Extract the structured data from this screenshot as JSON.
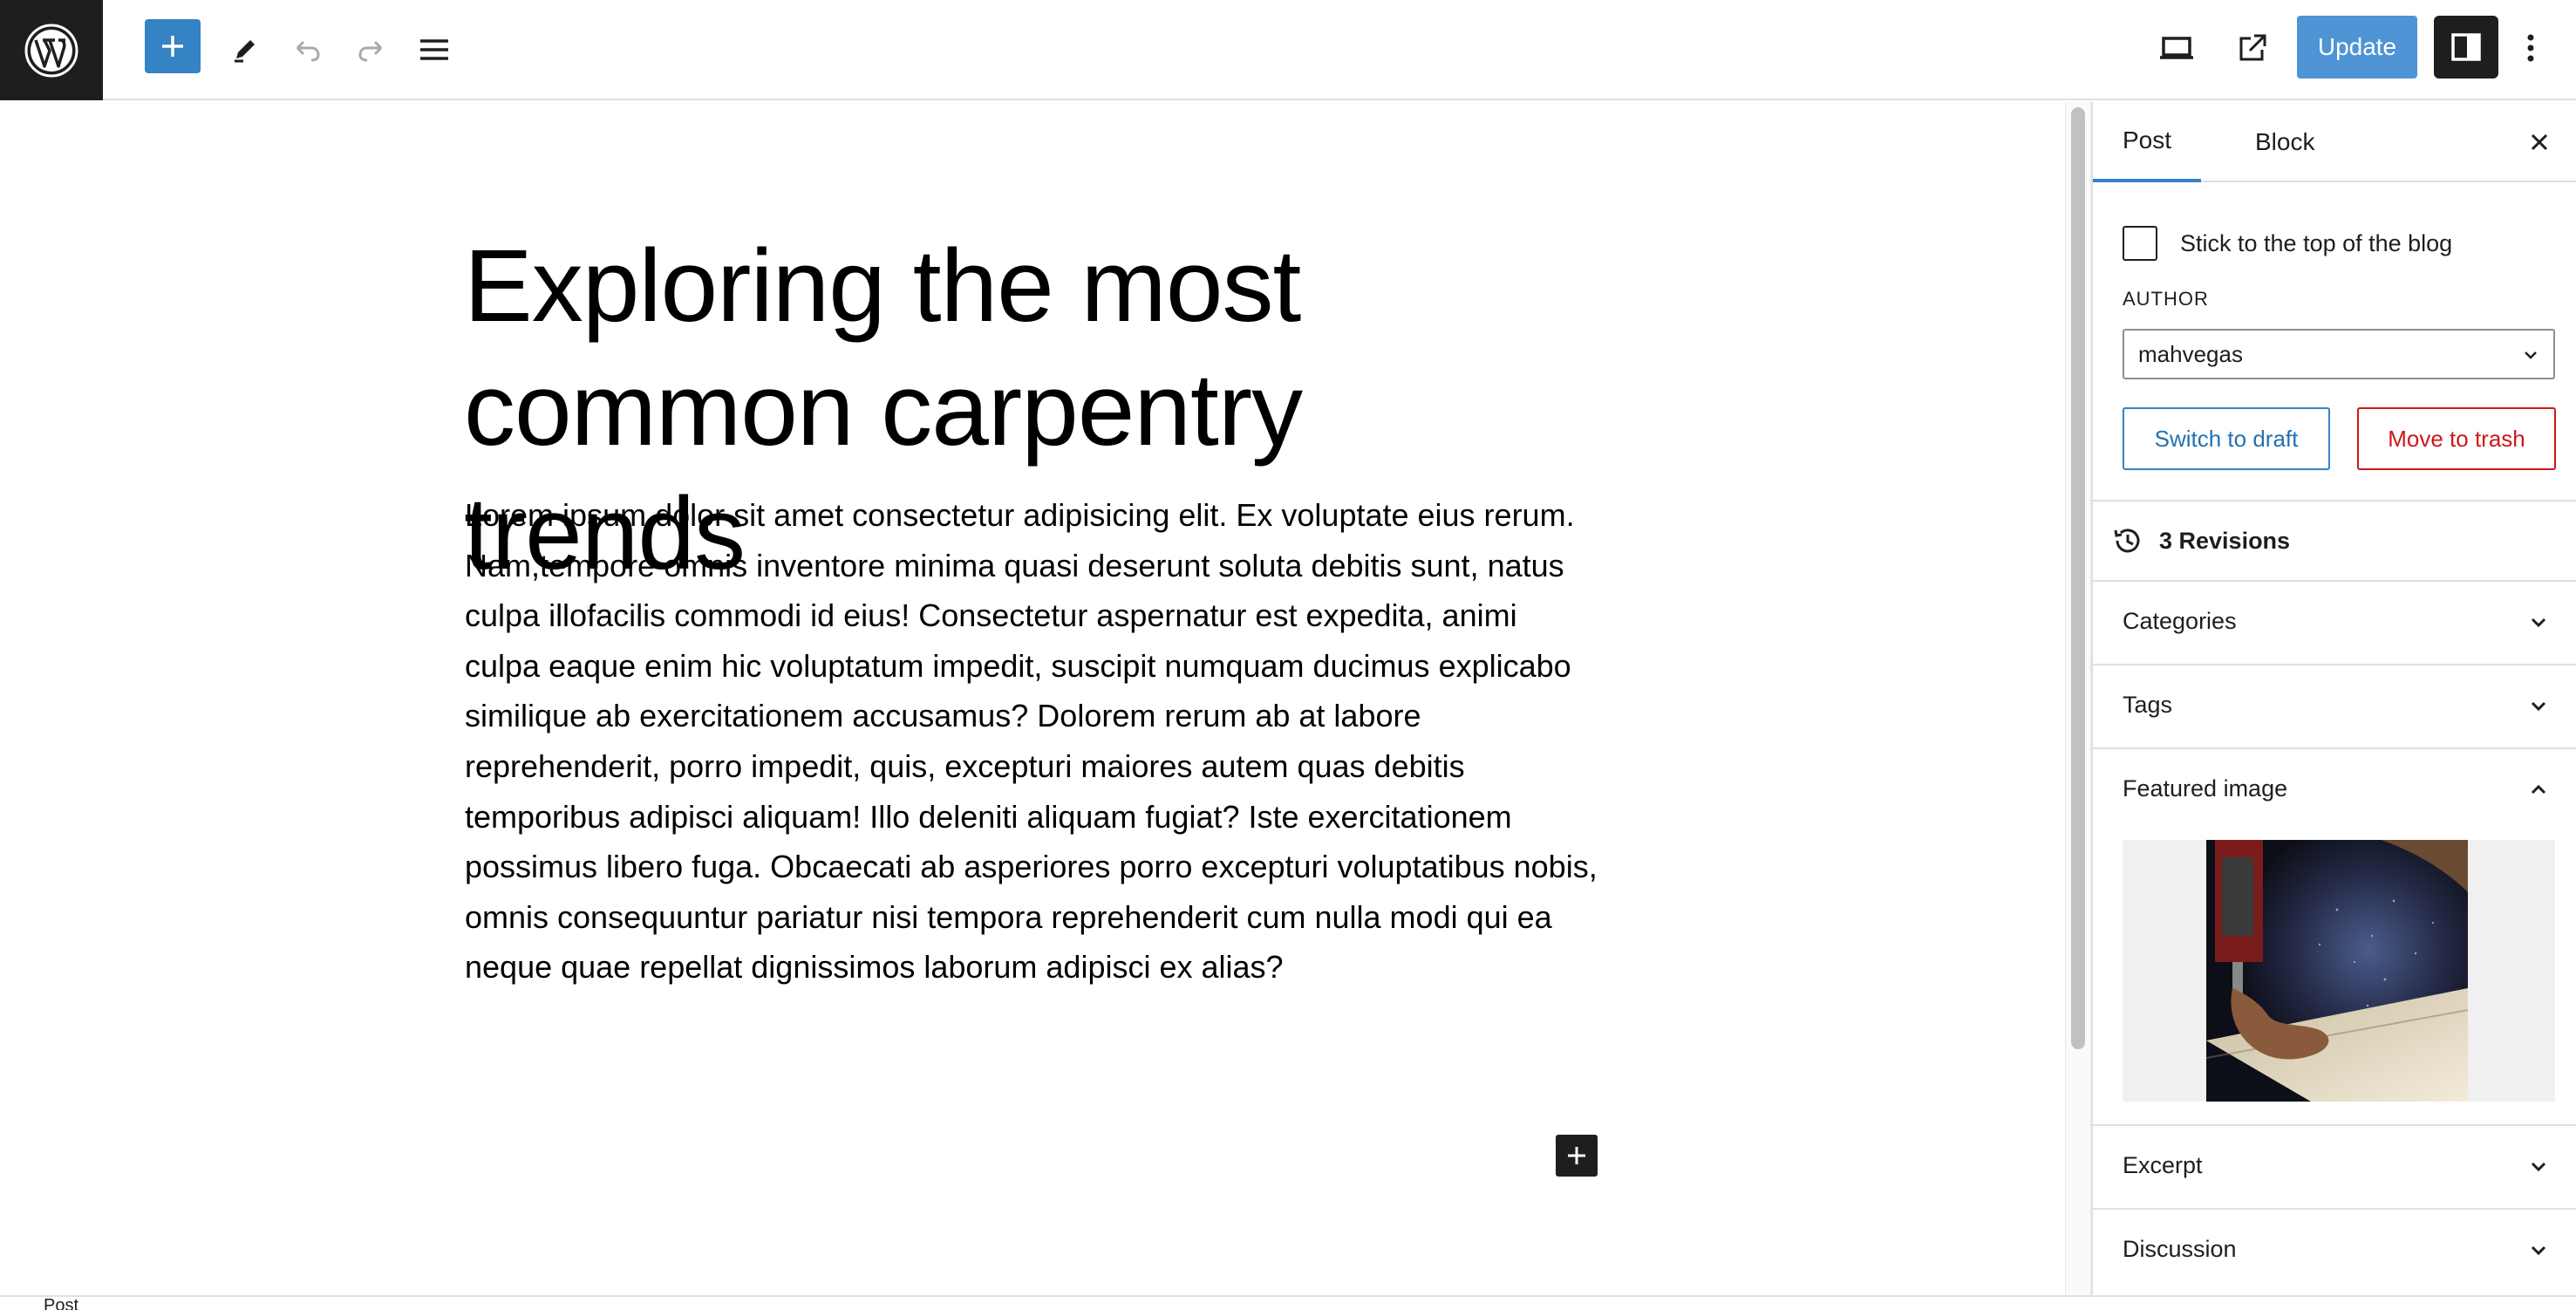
{
  "toolbar": {
    "logo": "wordpress-logo",
    "inserter_icon": "plus-icon",
    "tools_icon": "pencil-icon",
    "undo_icon": "undo-icon",
    "redo_icon": "redo-icon",
    "document_overview_icon": "list-view-icon",
    "preview_icon": "laptop-icon",
    "view_post_icon": "external-link-icon",
    "update_label": "Update",
    "settings_icon": "sidebar-toggle-icon",
    "options_icon": "more-vertical-icon"
  },
  "editor": {
    "title": "Exploring the most common carpentry trends",
    "body": "Lorem ipsum dolor sit amet consectetur adipisicing elit. Ex voluptate eius rerum. Nam,tempore omnis inventore minima quasi deserunt soluta debitis sunt, natus culpa illofacilis commodi id eius! Consectetur aspernatur est expedita, animi culpa eaque enim hic voluptatum impedit, suscipit numquam ducimus explicabo similique ab exercitationem accusamus? Dolorem rerum ab at labore reprehenderit, porro impedit, quis, excepturi maiores autem quas debitis temporibus adipisci aliquam! Illo deleniti aliquam fugiat? Iste exercitationem possimus libero fuga. Obcaecati ab asperiores porro excepturi voluptatibus nobis, omnis consequuntur pariatur nisi tempora reprehenderit cum nulla modi qui ea neque quae repellat dignissimos laborum adipisci ex alias?"
  },
  "sidebar": {
    "tabs": [
      {
        "label": "Post",
        "active": true
      },
      {
        "label": "Block",
        "active": false
      }
    ],
    "sticky_label": "Stick to the top of the blog",
    "sticky_checked": false,
    "author_label": "AUTHOR",
    "author_value": "mahvegas",
    "switch_draft_label": "Switch to draft",
    "trash_label": "Move to trash",
    "revisions_label": "3 Revisions",
    "panels": {
      "categories": "Categories",
      "tags": "Tags",
      "featured_image": "Featured image",
      "excerpt": "Excerpt",
      "discussion": "Discussion"
    }
  },
  "statusbar": {
    "breadcrumb": "Post"
  },
  "colors": {
    "accent": "#3582c4",
    "update_button": "#4f94d4",
    "danger": "#cc1818",
    "dark": "#1e1e1e"
  }
}
